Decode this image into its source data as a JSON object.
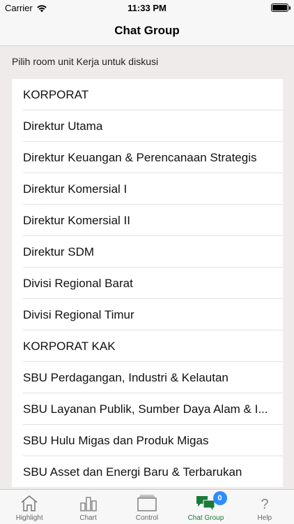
{
  "status_bar": {
    "carrier": "Carrier",
    "time": "11:33 PM"
  },
  "nav": {
    "title": "Chat Group"
  },
  "section": {
    "header": "Pilih room unit Kerja untuk diskusi"
  },
  "rooms": [
    "KORPORAT",
    "Direktur Utama",
    "Direktur Keuangan & Perencanaan Strategis",
    "Direktur Komersial I",
    "Direktur Komersial II",
    "Direktur SDM",
    "Divisi Regional Barat",
    "Divisi Regional Timur",
    "KORPORAT KAK",
    "SBU Perdagangan, Industri & Kelautan",
    "SBU Layanan Publik, Sumber Daya Alam & I...",
    "SBU Hulu Migas dan Produk Migas",
    "SBU Asset dan Energi Baru & Terbarukan"
  ],
  "tab_bar": {
    "tabs": [
      {
        "label": "Highlight",
        "icon": "home-icon"
      },
      {
        "label": "Chart",
        "icon": "bar-chart-icon"
      },
      {
        "label": "Control",
        "icon": "folder-icon"
      },
      {
        "label": "Chat Group",
        "icon": "chat-bubbles-icon",
        "active": true,
        "badge": "0"
      },
      {
        "label": "Help",
        "icon": "help-icon"
      }
    ],
    "active_color": "#1a7a3a",
    "badge_color": "#2f8cff"
  }
}
